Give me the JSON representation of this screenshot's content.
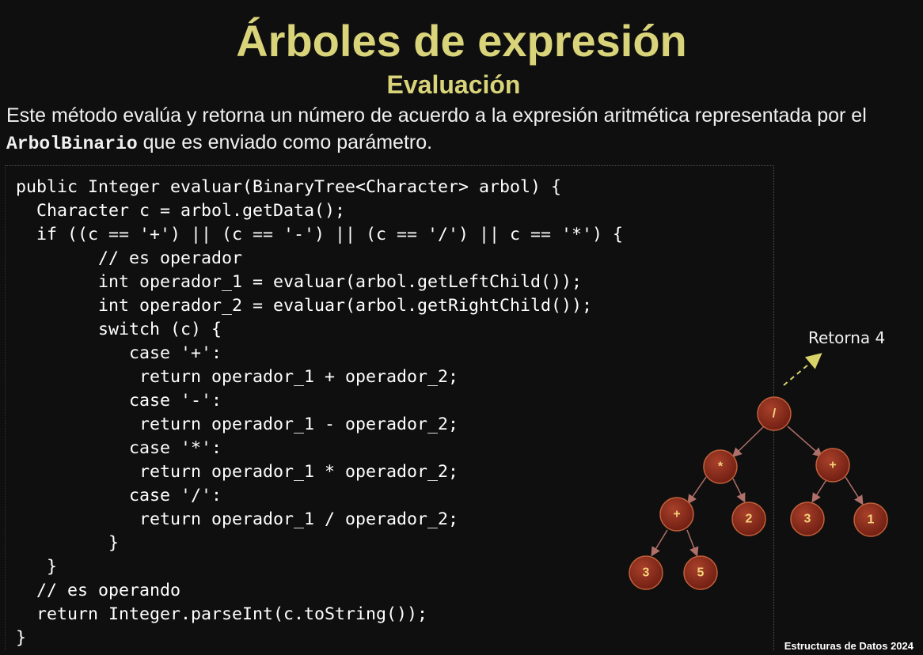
{
  "slide": {
    "title": "Árboles de expresión",
    "subtitle": "Evaluación",
    "description": {
      "part1": "Este método evalúa y retorna un número de acuerdo a la expresión aritmética representada por el ",
      "class_name": "ArbolBinario",
      "part2": " que es enviado como parámetro."
    },
    "code_lines": [
      "public Integer evaluar(BinaryTree<Character> arbol) {",
      "  Character c = arbol.getData();",
      "  if ((c == '+') || (c == '-') || (c == '/') || c == '*') {",
      "        // es operador",
      "        int operador_1 = evaluar(arbol.getLeftChild());",
      "        int operador_2 = evaluar(arbol.getRightChild());",
      "        switch (c) {",
      "           case '+':",
      "            return operador_1 + operador_2;",
      "           case '-':",
      "            return operador_1 - operador_2;",
      "           case '*':",
      "            return operador_1 * operador_2;",
      "           case '/':",
      "            return operador_1 / operador_2;",
      "         }",
      "   }",
      "  // es operando",
      "  return Integer.parseInt(c.toString());",
      "}"
    ],
    "tree": {
      "return_label": "Retorna 4",
      "nodes": {
        "root": "/",
        "left": "*",
        "right": "+",
        "left_left": "+",
        "left_right": "2",
        "right_left": "3",
        "right_right": "1",
        "left_left_left": "3",
        "left_left_right": "5"
      }
    },
    "footer": "Estructuras de Datos 2024"
  },
  "colors": {
    "background": "#0f0f0f",
    "title": "#d9d47a",
    "node_fill": "#8e2a1a",
    "node_text": "#f2d27a",
    "edge": "#b0706a",
    "arrow": "#d8d46a"
  }
}
